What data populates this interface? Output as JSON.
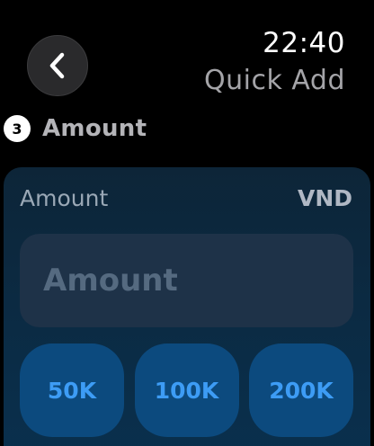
{
  "header": {
    "time": "22:40",
    "app_title": "Quick Add",
    "back_icon": "chevron-left-icon"
  },
  "step": {
    "number": "3",
    "title": "Amount"
  },
  "amount_card": {
    "label": "Amount",
    "currency": "VND",
    "input": {
      "value": "",
      "placeholder": "Amount"
    },
    "quick_amounts": [
      "50K",
      "100K",
      "200K"
    ]
  },
  "colors": {
    "accent": "#3d9cf5",
    "card_background": "#0d2538",
    "button_background": "#0c4a7e"
  }
}
